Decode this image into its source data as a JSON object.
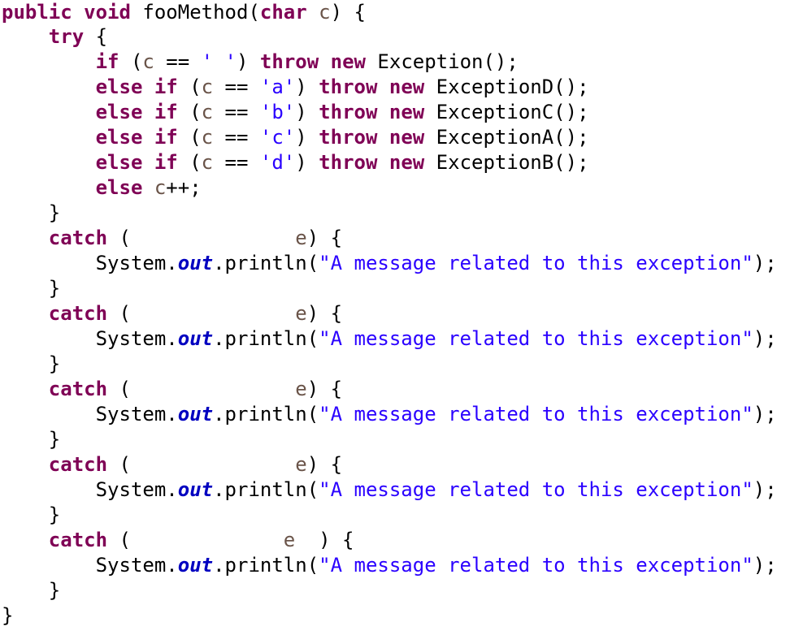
{
  "editor": {
    "language": "java",
    "background": "#ffffff",
    "font_size_px": 24,
    "line_height_px": 31,
    "colors": {
      "keyword": "#7F0055",
      "string": "#2A00FF",
      "char_literal": "#2A00FF",
      "local_variable": "#6A5449",
      "static_field": "#0000C0",
      "plain": "#000000"
    },
    "blank_label": "fill-in-the-blank exception type",
    "lines": [
      {
        "number": 1,
        "indent": 0,
        "tokens": [
          {
            "t": "public",
            "k": "kw"
          },
          {
            "t": " ",
            "k": "plain"
          },
          {
            "t": "void",
            "k": "kw"
          },
          {
            "t": " fooMethod(",
            "k": "plain"
          },
          {
            "t": "char",
            "k": "kw"
          },
          {
            "t": " ",
            "k": "plain"
          },
          {
            "t": "c",
            "k": "param"
          },
          {
            "t": ") {",
            "k": "plain"
          }
        ]
      },
      {
        "number": 2,
        "indent": 1,
        "tokens": [
          {
            "t": "try",
            "k": "kw"
          },
          {
            "t": " {",
            "k": "plain"
          }
        ]
      },
      {
        "number": 3,
        "indent": 2,
        "tokens": [
          {
            "t": "if",
            "k": "kw"
          },
          {
            "t": " (",
            "k": "plain"
          },
          {
            "t": "c",
            "k": "param"
          },
          {
            "t": " == ",
            "k": "plain"
          },
          {
            "t": "' '",
            "k": "char"
          },
          {
            "t": ") ",
            "k": "plain"
          },
          {
            "t": "throw",
            "k": "kw"
          },
          {
            "t": " ",
            "k": "plain"
          },
          {
            "t": "new",
            "k": "kw"
          },
          {
            "t": " Exception();",
            "k": "plain"
          }
        ]
      },
      {
        "number": 4,
        "indent": 2,
        "tokens": [
          {
            "t": "else",
            "k": "kw"
          },
          {
            "t": " ",
            "k": "plain"
          },
          {
            "t": "if",
            "k": "kw"
          },
          {
            "t": " (",
            "k": "plain"
          },
          {
            "t": "c",
            "k": "param"
          },
          {
            "t": " == ",
            "k": "plain"
          },
          {
            "t": "'a'",
            "k": "char"
          },
          {
            "t": ") ",
            "k": "plain"
          },
          {
            "t": "throw",
            "k": "kw"
          },
          {
            "t": " ",
            "k": "plain"
          },
          {
            "t": "new",
            "k": "kw"
          },
          {
            "t": " ExceptionD();",
            "k": "plain"
          }
        ]
      },
      {
        "number": 5,
        "indent": 2,
        "tokens": [
          {
            "t": "else",
            "k": "kw"
          },
          {
            "t": " ",
            "k": "plain"
          },
          {
            "t": "if",
            "k": "kw"
          },
          {
            "t": " (",
            "k": "plain"
          },
          {
            "t": "c",
            "k": "param"
          },
          {
            "t": " == ",
            "k": "plain"
          },
          {
            "t": "'b'",
            "k": "char"
          },
          {
            "t": ") ",
            "k": "plain"
          },
          {
            "t": "throw",
            "k": "kw"
          },
          {
            "t": " ",
            "k": "plain"
          },
          {
            "t": "new",
            "k": "kw"
          },
          {
            "t": " ExceptionC();",
            "k": "plain"
          }
        ]
      },
      {
        "number": 6,
        "indent": 2,
        "tokens": [
          {
            "t": "else",
            "k": "kw"
          },
          {
            "t": " ",
            "k": "plain"
          },
          {
            "t": "if",
            "k": "kw"
          },
          {
            "t": " (",
            "k": "plain"
          },
          {
            "t": "c",
            "k": "param"
          },
          {
            "t": " == ",
            "k": "plain"
          },
          {
            "t": "'c'",
            "k": "char"
          },
          {
            "t": ") ",
            "k": "plain"
          },
          {
            "t": "throw",
            "k": "kw"
          },
          {
            "t": " ",
            "k": "plain"
          },
          {
            "t": "new",
            "k": "kw"
          },
          {
            "t": " ExceptionA();",
            "k": "plain"
          }
        ]
      },
      {
        "number": 7,
        "indent": 2,
        "tokens": [
          {
            "t": "else",
            "k": "kw"
          },
          {
            "t": " ",
            "k": "plain"
          },
          {
            "t": "if",
            "k": "kw"
          },
          {
            "t": " (",
            "k": "plain"
          },
          {
            "t": "c",
            "k": "param"
          },
          {
            "t": " == ",
            "k": "plain"
          },
          {
            "t": "'d'",
            "k": "char"
          },
          {
            "t": ") ",
            "k": "plain"
          },
          {
            "t": "throw",
            "k": "kw"
          },
          {
            "t": " ",
            "k": "plain"
          },
          {
            "t": "new",
            "k": "kw"
          },
          {
            "t": " ExceptionB();",
            "k": "plain"
          }
        ]
      },
      {
        "number": 8,
        "indent": 2,
        "tokens": [
          {
            "t": "else",
            "k": "kw"
          },
          {
            "t": " ",
            "k": "plain"
          },
          {
            "t": "c",
            "k": "param"
          },
          {
            "t": "++;",
            "k": "plain"
          }
        ]
      },
      {
        "number": 9,
        "indent": 1,
        "tokens": [
          {
            "t": "}",
            "k": "plain"
          }
        ]
      },
      {
        "number": 10,
        "indent": 1,
        "tokens": [
          {
            "t": "catch",
            "k": "kw"
          },
          {
            "t": " (",
            "k": "plain"
          },
          {
            "t": "              ",
            "k": "blank"
          },
          {
            "t": "e",
            "k": "param"
          },
          {
            "t": ") {",
            "k": "plain"
          }
        ]
      },
      {
        "number": 11,
        "indent": 2,
        "tokens": [
          {
            "t": "System",
            "k": "plain"
          },
          {
            "t": ".",
            "k": "plain"
          },
          {
            "t": "out",
            "k": "field"
          },
          {
            "t": ".println(",
            "k": "plain"
          },
          {
            "t": "\"A message related to this exception\"",
            "k": "str"
          },
          {
            "t": ");",
            "k": "plain"
          }
        ]
      },
      {
        "number": 12,
        "indent": 1,
        "tokens": [
          {
            "t": "}",
            "k": "plain"
          }
        ]
      },
      {
        "number": 13,
        "indent": 1,
        "tokens": [
          {
            "t": "catch",
            "k": "kw"
          },
          {
            "t": " (",
            "k": "plain"
          },
          {
            "t": "              ",
            "k": "blank"
          },
          {
            "t": "e",
            "k": "param"
          },
          {
            "t": ") {",
            "k": "plain"
          }
        ]
      },
      {
        "number": 14,
        "indent": 2,
        "tokens": [
          {
            "t": "System",
            "k": "plain"
          },
          {
            "t": ".",
            "k": "plain"
          },
          {
            "t": "out",
            "k": "field"
          },
          {
            "t": ".println(",
            "k": "plain"
          },
          {
            "t": "\"A message related to this exception\"",
            "k": "str"
          },
          {
            "t": ");",
            "k": "plain"
          }
        ]
      },
      {
        "number": 15,
        "indent": 1,
        "tokens": [
          {
            "t": "}",
            "k": "plain"
          }
        ]
      },
      {
        "number": 16,
        "indent": 1,
        "tokens": [
          {
            "t": "catch",
            "k": "kw"
          },
          {
            "t": " (",
            "k": "plain"
          },
          {
            "t": "              ",
            "k": "blank"
          },
          {
            "t": "e",
            "k": "param"
          },
          {
            "t": ") {",
            "k": "plain"
          }
        ]
      },
      {
        "number": 17,
        "indent": 2,
        "tokens": [
          {
            "t": "System",
            "k": "plain"
          },
          {
            "t": ".",
            "k": "plain"
          },
          {
            "t": "out",
            "k": "field"
          },
          {
            "t": ".println(",
            "k": "plain"
          },
          {
            "t": "\"A message related to this exception\"",
            "k": "str"
          },
          {
            "t": ");",
            "k": "plain"
          }
        ]
      },
      {
        "number": 18,
        "indent": 1,
        "tokens": [
          {
            "t": "}",
            "k": "plain"
          }
        ]
      },
      {
        "number": 19,
        "indent": 1,
        "tokens": [
          {
            "t": "catch",
            "k": "kw"
          },
          {
            "t": " (",
            "k": "plain"
          },
          {
            "t": "              ",
            "k": "blank"
          },
          {
            "t": "e",
            "k": "param"
          },
          {
            "t": ") {",
            "k": "plain"
          }
        ]
      },
      {
        "number": 20,
        "indent": 2,
        "tokens": [
          {
            "t": "System",
            "k": "plain"
          },
          {
            "t": ".",
            "k": "plain"
          },
          {
            "t": "out",
            "k": "field"
          },
          {
            "t": ".println(",
            "k": "plain"
          },
          {
            "t": "\"A message related to this exception\"",
            "k": "str"
          },
          {
            "t": ");",
            "k": "plain"
          }
        ]
      },
      {
        "number": 21,
        "indent": 1,
        "tokens": [
          {
            "t": "}",
            "k": "plain"
          }
        ]
      },
      {
        "number": 22,
        "indent": 1,
        "tokens": [
          {
            "t": "catch",
            "k": "kw"
          },
          {
            "t": " (",
            "k": "plain"
          },
          {
            "t": "             ",
            "k": "blank"
          },
          {
            "t": "e",
            "k": "param"
          },
          {
            "t": "  ) {",
            "k": "plain"
          }
        ]
      },
      {
        "number": 23,
        "indent": 2,
        "tokens": [
          {
            "t": "System",
            "k": "plain"
          },
          {
            "t": ".",
            "k": "plain"
          },
          {
            "t": "out",
            "k": "field"
          },
          {
            "t": ".println(",
            "k": "plain"
          },
          {
            "t": "\"A message related to this exception\"",
            "k": "str"
          },
          {
            "t": ");",
            "k": "plain"
          }
        ]
      },
      {
        "number": 24,
        "indent": 1,
        "tokens": [
          {
            "t": "}",
            "k": "plain"
          }
        ]
      },
      {
        "number": 25,
        "indent": 0,
        "tokens": [
          {
            "t": "}",
            "k": "plain"
          }
        ]
      }
    ]
  }
}
